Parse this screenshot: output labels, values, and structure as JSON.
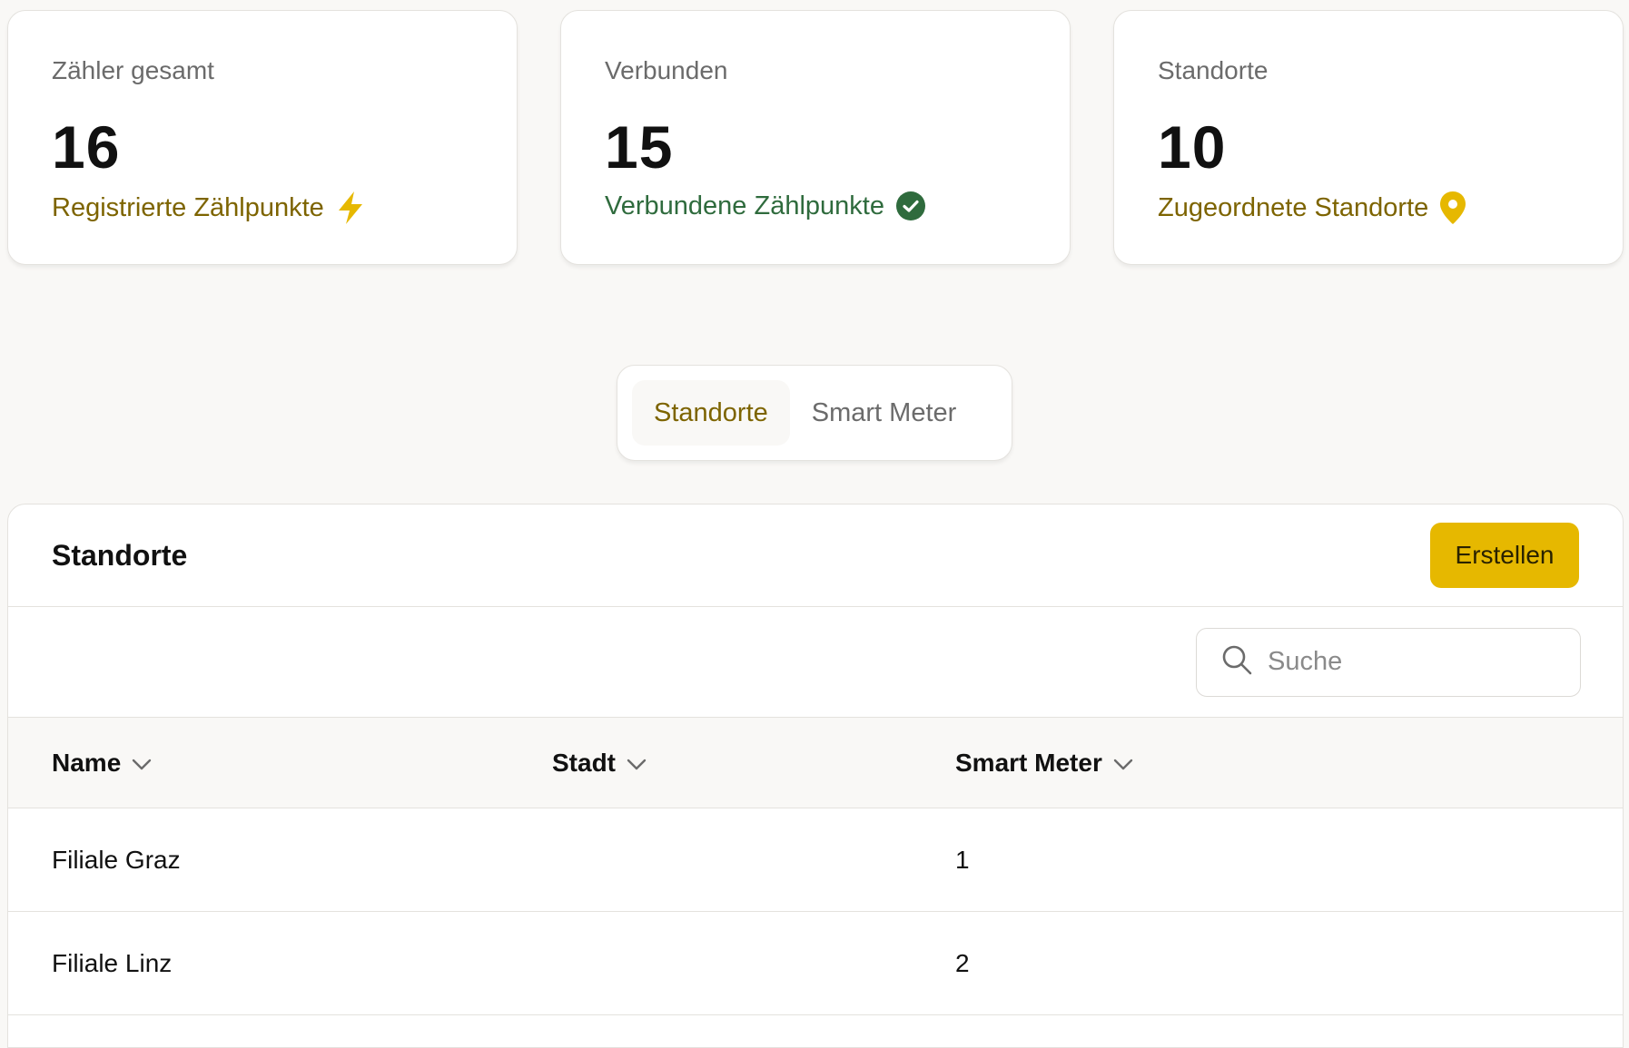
{
  "stats": [
    {
      "label": "Zähler gesamt",
      "value": "16",
      "sub": "Registrierte Zählpunkte",
      "icon": "lightning-icon",
      "tone": "gold"
    },
    {
      "label": "Verbunden",
      "value": "15",
      "sub": "Verbundene Zählpunkte",
      "icon": "check-circle-icon",
      "tone": "green"
    },
    {
      "label": "Standorte",
      "value": "10",
      "sub": "Zugeordnete Standorte",
      "icon": "map-pin-icon",
      "tone": "gold"
    }
  ],
  "tabs": [
    {
      "label": "Standorte",
      "active": true
    },
    {
      "label": "Smart Meter",
      "active": false
    }
  ],
  "panel": {
    "title": "Standorte",
    "create_label": "Erstellen",
    "search_placeholder": "Suche"
  },
  "table": {
    "columns": [
      "Name",
      "Stadt",
      "Smart Meter"
    ],
    "rows": [
      {
        "name": "Filiale Graz",
        "city": "",
        "meters": "1"
      },
      {
        "name": "Filiale Linz",
        "city": "",
        "meters": "2"
      }
    ]
  },
  "colors": {
    "accent": "#e6b800",
    "accent_text": "#7d6400",
    "success": "#2f6b3d",
    "background": "#f9f8f6"
  }
}
